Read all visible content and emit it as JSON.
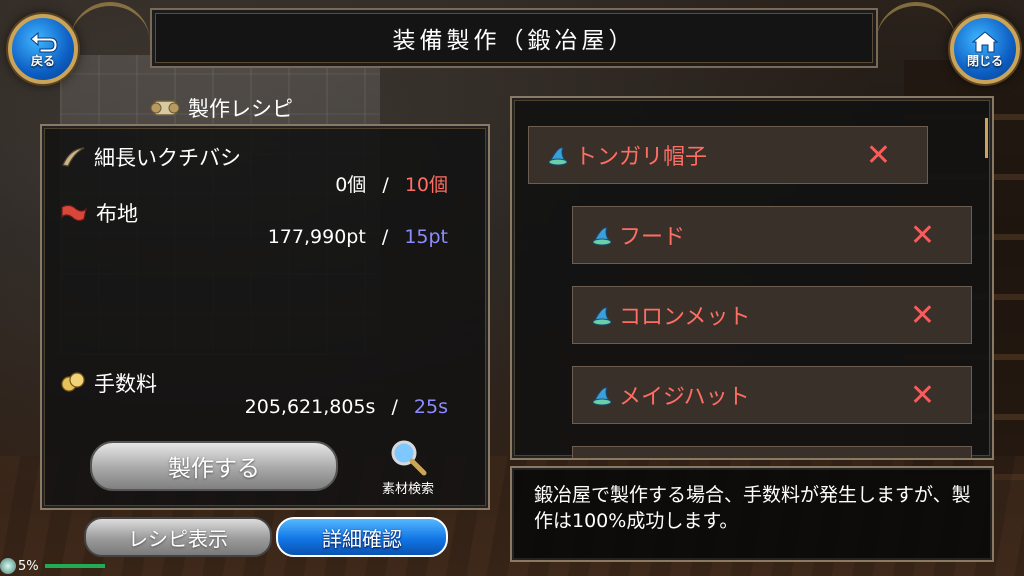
{
  "header": {
    "title": "装備製作（鍛冶屋）"
  },
  "nav": {
    "back_label": "戻る",
    "close_label": "閉じる"
  },
  "recipe": {
    "title": "製作レシピ",
    "materials": [
      {
        "name": "細長いクチバシ",
        "have": "0個",
        "sep": "/",
        "need": "10個"
      },
      {
        "name": "布地",
        "have": "177,990pt",
        "sep": "/",
        "need": "15pt"
      }
    ],
    "fee": {
      "name": "手数料",
      "have": "205,621,805s",
      "sep": "/",
      "need": "25s"
    },
    "craft_button": "製作する",
    "search_label": "素材検索"
  },
  "buttons": {
    "recipe_view": "レシピ表示",
    "detail_check": "詳細確認"
  },
  "tree": {
    "items": [
      {
        "name": "トンガリ帽子",
        "mark": "✕"
      },
      {
        "name": "フード",
        "mark": "✕"
      },
      {
        "name": "コロンメット",
        "mark": "✕"
      },
      {
        "name": "メイジハット",
        "mark": "✕"
      }
    ]
  },
  "info": {
    "message": "鍛冶屋で製作する場合、手数料が発生しますが、製作は100%成功します。"
  },
  "status": {
    "percent": "5%"
  },
  "colors": {
    "shortage": "#ff6e63",
    "points": "#8c8cff",
    "accent_blue": "#1276e6",
    "frame": "#8a7a63"
  }
}
